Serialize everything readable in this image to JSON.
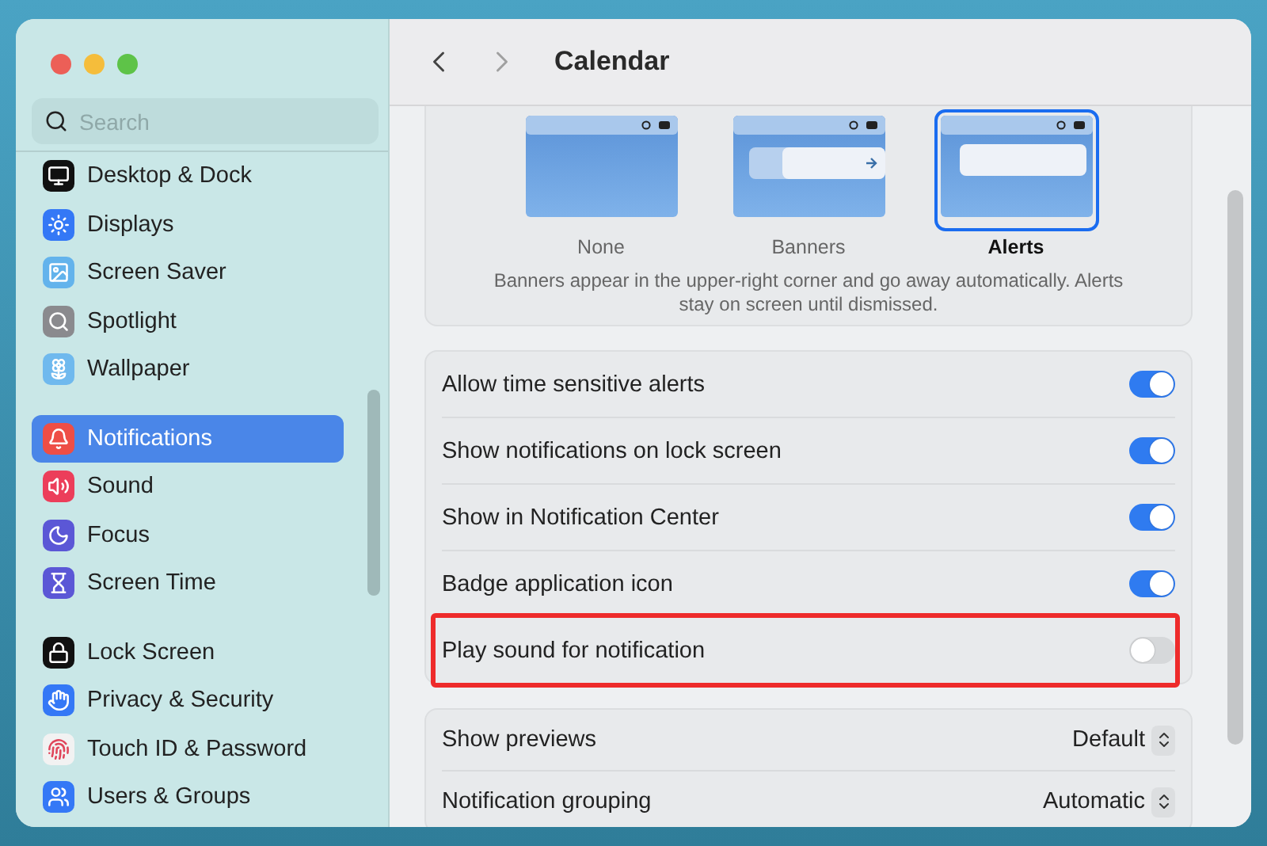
{
  "window": {
    "title": "Calendar"
  },
  "sidebar": {
    "search": {
      "placeholder": "Search"
    },
    "groups": [
      {
        "items": [
          {
            "label": "Desktop & Dock",
            "selected": false
          },
          {
            "label": "Displays",
            "selected": false
          },
          {
            "label": "Screen Saver",
            "selected": false
          },
          {
            "label": "Spotlight",
            "selected": false
          },
          {
            "label": "Wallpaper",
            "selected": false
          }
        ]
      },
      {
        "items": [
          {
            "label": "Notifications",
            "selected": true
          },
          {
            "label": "Sound",
            "selected": false
          },
          {
            "label": "Focus",
            "selected": false
          },
          {
            "label": "Screen Time",
            "selected": false
          }
        ]
      },
      {
        "items": [
          {
            "label": "Lock Screen",
            "selected": false
          },
          {
            "label": "Privacy & Security",
            "selected": false
          },
          {
            "label": "Touch ID & Password",
            "selected": false
          },
          {
            "label": "Users & Groups",
            "selected": false
          }
        ]
      }
    ]
  },
  "alert_styles": [
    {
      "label": "None",
      "selected": false,
      "kind": "none"
    },
    {
      "label": "Banners",
      "selected": false,
      "kind": "banner"
    },
    {
      "label": "Alerts",
      "selected": true,
      "kind": "alert"
    }
  ],
  "alert_description": "Banners appear in the upper-right corner and go away automatically. Alerts stay on screen until dismissed.",
  "toggles": [
    {
      "label": "Allow time sensitive alerts",
      "on": true,
      "highlighted": false
    },
    {
      "label": "Show notifications on lock screen",
      "on": true,
      "highlighted": false
    },
    {
      "label": "Show in Notification Center",
      "on": true,
      "highlighted": false
    },
    {
      "label": "Badge application icon",
      "on": true,
      "highlighted": false
    },
    {
      "label": "Play sound for notification",
      "on": false,
      "highlighted": true
    }
  ],
  "popups": [
    {
      "label": "Show previews",
      "value": "Default"
    },
    {
      "label": "Notification grouping",
      "value": "Automatic"
    }
  ]
}
